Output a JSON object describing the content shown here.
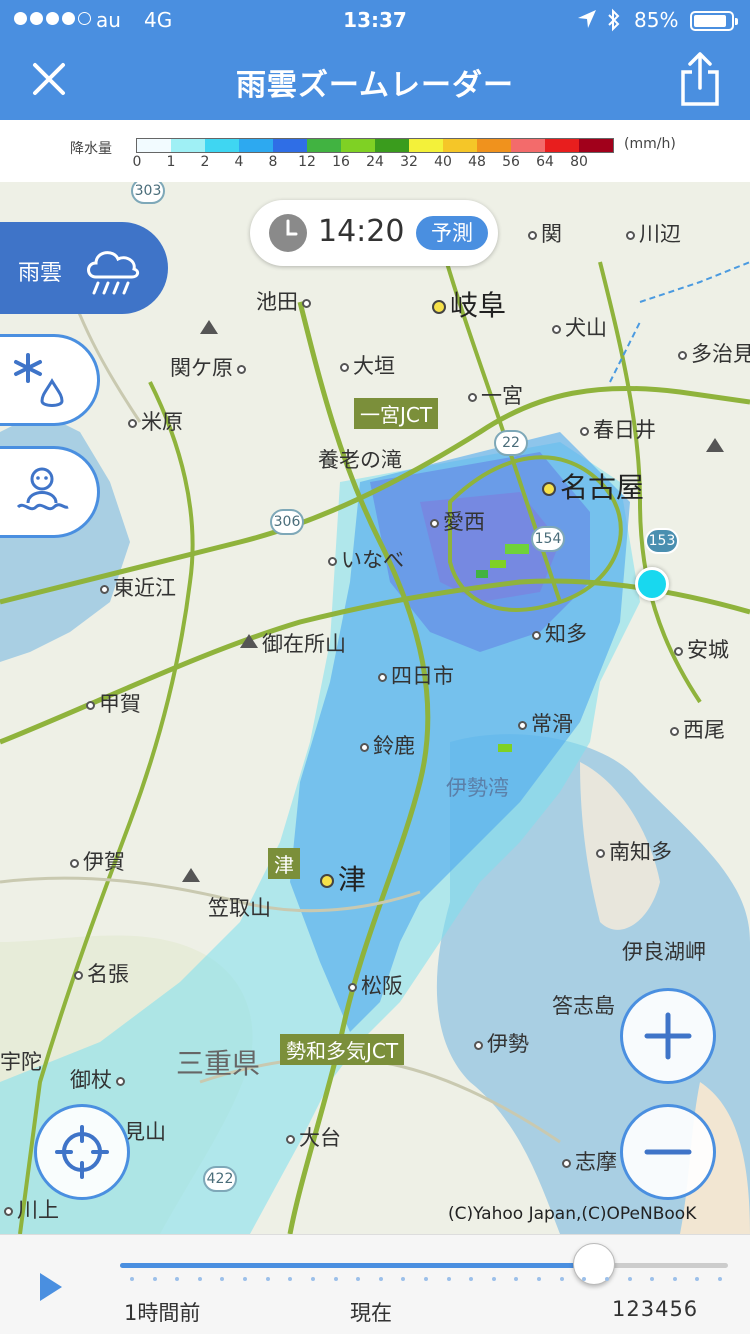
{
  "status_bar": {
    "carrier": "au",
    "network": "4G",
    "time": "13:37",
    "battery": "85%",
    "signal_bars": 4,
    "signal_total": 5,
    "battery_level": 0.85
  },
  "header": {
    "title": "雨雲ズームレーダー",
    "background_color": "#4a8fe0"
  },
  "legend": {
    "label": "降水量",
    "unit": "(mm/h)",
    "ticks": [
      "0",
      "1",
      "2",
      "4",
      "8",
      "12",
      "16",
      "24",
      "32",
      "40",
      "48",
      "56",
      "64",
      "80"
    ],
    "colors": [
      "#f2fbff",
      "#9ff0f5",
      "#3fd6f2",
      "#2da9f0",
      "#2f6ee6",
      "#41b341",
      "#7fd124",
      "#3a9c1d",
      "#f3f13a",
      "#f5c628",
      "#f0921d",
      "#f36b6b",
      "#e81e1e",
      "#a1001b"
    ]
  },
  "time_chip": {
    "time": "14:20",
    "badge": "予測"
  },
  "side_tabs": [
    {
      "label": "雨雲"
    },
    {
      "label": ""
    },
    {
      "label": ""
    }
  ],
  "map": {
    "places": [
      {
        "name": "関"
      },
      {
        "name": "川辺"
      },
      {
        "name": "岐阜"
      },
      {
        "name": "池田"
      },
      {
        "name": "犬山"
      },
      {
        "name": "多治見"
      },
      {
        "name": "関ケ原"
      },
      {
        "name": "大垣"
      },
      {
        "name": "一宮"
      },
      {
        "name": "米原"
      },
      {
        "name": "春日井"
      },
      {
        "name": "養老の滝"
      },
      {
        "name": "名古屋"
      },
      {
        "name": "愛西"
      },
      {
        "name": "いなべ"
      },
      {
        "name": "東近江"
      },
      {
        "name": "御在所山"
      },
      {
        "name": "知多"
      },
      {
        "name": "安城"
      },
      {
        "name": "四日市"
      },
      {
        "name": "甲賀"
      },
      {
        "name": "常滑"
      },
      {
        "name": "西尾"
      },
      {
        "name": "鈴鹿"
      },
      {
        "name": "伊勢湾"
      },
      {
        "name": "伊賀"
      },
      {
        "name": "津"
      },
      {
        "name": "南知多"
      },
      {
        "name": "笠取山"
      },
      {
        "name": "伊良湖岬"
      },
      {
        "name": "名張"
      },
      {
        "name": "松阪"
      },
      {
        "name": "答志島"
      },
      {
        "name": "宇陀"
      },
      {
        "name": "三重県"
      },
      {
        "name": "伊勢"
      },
      {
        "name": "御杖"
      },
      {
        "name": "見山"
      },
      {
        "name": "大台"
      },
      {
        "name": "志摩"
      },
      {
        "name": "川上"
      }
    ],
    "tags": [
      "一宮JCT",
      "津",
      "勢和多気JCT"
    ],
    "routes": [
      "303",
      "22",
      "306",
      "154",
      "153",
      "422"
    ],
    "credit": "(C)Yahoo Japan,(C)OPeNBooK"
  },
  "timeline": {
    "label_past": "1時間前",
    "label_now": "現在",
    "label_future": "123456",
    "position": 0.78
  }
}
